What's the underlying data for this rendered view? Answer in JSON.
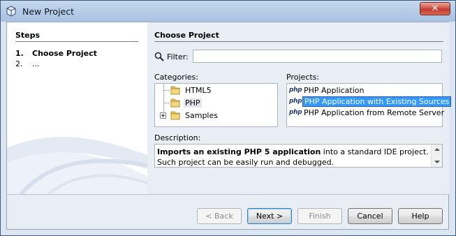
{
  "window": {
    "title": "New Project",
    "close_label": "✕"
  },
  "steps": {
    "title": "Steps",
    "items": [
      {
        "num": "1.",
        "label": "Choose Project"
      },
      {
        "num": "2.",
        "label": "..."
      }
    ]
  },
  "main": {
    "title": "Choose Project",
    "filter": {
      "label": "Filter:",
      "value": "",
      "placeholder": ""
    },
    "categories": {
      "label": "Categories:",
      "items": [
        "HTML5",
        "PHP",
        "Samples"
      ],
      "selected": "PHP"
    },
    "projects": {
      "label": "Projects:",
      "items": [
        "PHP Application",
        "PHP Application with Existing Sources",
        "PHP Application from Remote Server"
      ],
      "selected": "PHP Application with Existing Sources",
      "icon_text": "php"
    },
    "description": {
      "label": "Description:",
      "bold": "Imports an existing PHP 5 application",
      "rest": " into a standard IDE project. Such project can be easily run and debugged."
    }
  },
  "buttons": {
    "back": "< Back",
    "next": "Next >",
    "finish": "Finish",
    "cancel": "Cancel",
    "help": "Help"
  },
  "colors": {
    "selection": "#3399ff",
    "title_bar": "#b7cde8",
    "close_button": "#c43a2c"
  }
}
